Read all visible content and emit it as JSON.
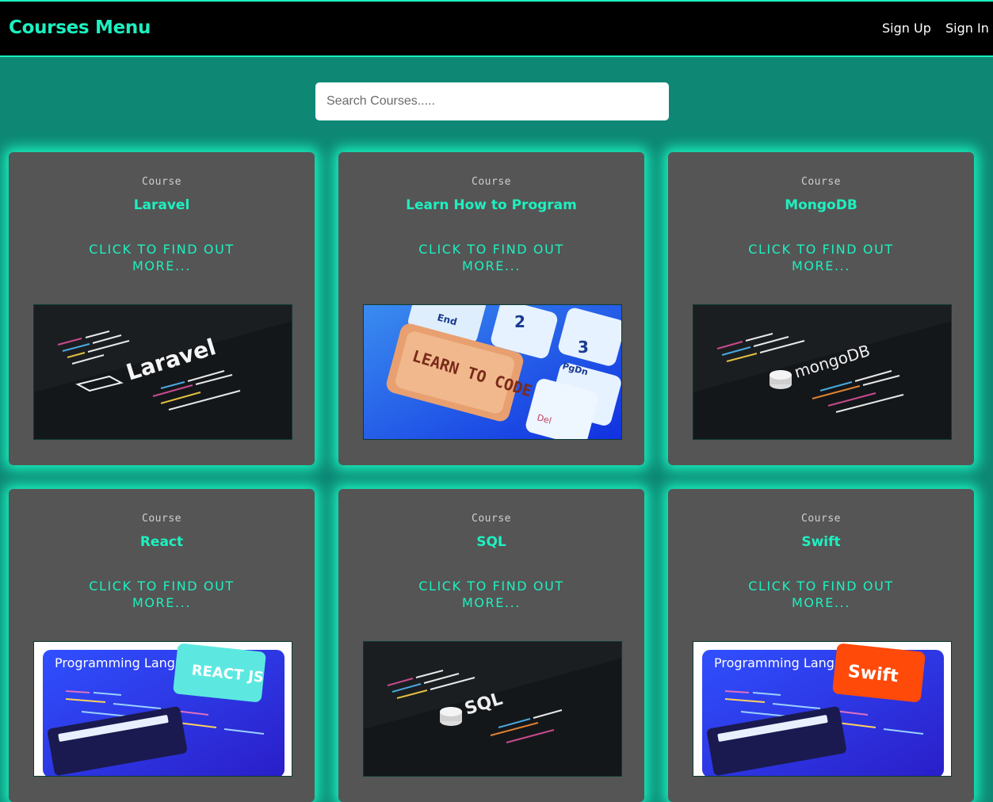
{
  "nav": {
    "brand": "Courses Menu",
    "links": [
      "Sign Up",
      "Sign In"
    ]
  },
  "search": {
    "placeholder": "Search Courses....."
  },
  "cards": [
    {
      "kicker": "Course",
      "title": "Laravel",
      "cta": "CLICK TO FIND OUT MORE...",
      "image_text": "Laravel"
    },
    {
      "kicker": "Course",
      "title": "Learn How to Program",
      "cta": "CLICK TO FIND OUT MORE...",
      "image_text": "LEARN TO CODE"
    },
    {
      "kicker": "Course",
      "title": "MongoDB",
      "cta": "CLICK TO FIND OUT MORE...",
      "image_text": "mongoDB"
    },
    {
      "kicker": "Course",
      "title": "React",
      "cta": "CLICK TO FIND OUT MORE...",
      "image_text": "REACT JS",
      "image_subtext": "Programming Language"
    },
    {
      "kicker": "Course",
      "title": "SQL",
      "cta": "CLICK TO FIND OUT MORE...",
      "image_text": "SQL"
    },
    {
      "kicker": "Course",
      "title": "Swift",
      "cta": "CLICK TO FIND OUT MORE...",
      "image_text": "Swift",
      "image_subtext": "Programming Language"
    }
  ],
  "colors": {
    "accent": "#1cf0c0",
    "page_bg": "#0e8875",
    "card_bg": "#555555",
    "nav_bg": "#000000"
  }
}
